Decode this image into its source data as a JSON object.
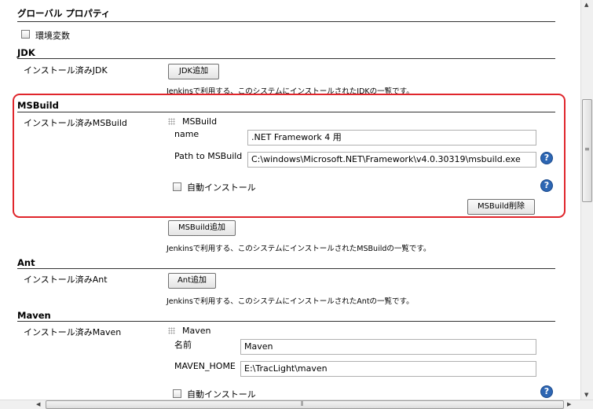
{
  "page": {
    "title": "グローバル プロパティ"
  },
  "env_vars": {
    "label": "環境変数"
  },
  "jdk": {
    "section": "JDK",
    "installed_label": "インストール済みJDK",
    "add_button": "JDK追加",
    "description": "Jenkinsで利用する、このシステムにインストールされたJDKの一覧です。"
  },
  "msbuild": {
    "section": "MSBuild",
    "installed_label": "インストール済みMSBuild",
    "item_title": "MSBuild",
    "name_label": "name",
    "name_value": ".NET Framework 4 用",
    "path_label": "Path to MSBuild",
    "path_value": "C:\\windows\\Microsoft.NET\\Framework\\v4.0.30319\\msbuild.exe",
    "auto_install_label": "自動インストール",
    "delete_button": "MSBuild削除",
    "add_button": "MSBuild追加",
    "description": "Jenkinsで利用する、このシステムにインストールされたMSBuildの一覧です。"
  },
  "ant": {
    "section": "Ant",
    "installed_label": "インストール済みAnt",
    "add_button": "Ant追加",
    "description": "Jenkinsで利用する、このシステムにインストールされたAntの一覧です。"
  },
  "maven": {
    "section": "Maven",
    "installed_label": "インストール済みMaven",
    "item_title": "Maven",
    "name_label": "名前",
    "name_value": "Maven",
    "home_label": "MAVEN_HOME",
    "home_value": "E:\\TracLight\\maven",
    "auto_install_label": "自動インストール"
  },
  "icons": {
    "help": "?"
  },
  "colors": {
    "highlight": "#e0262c",
    "help": "#2d66b3"
  }
}
